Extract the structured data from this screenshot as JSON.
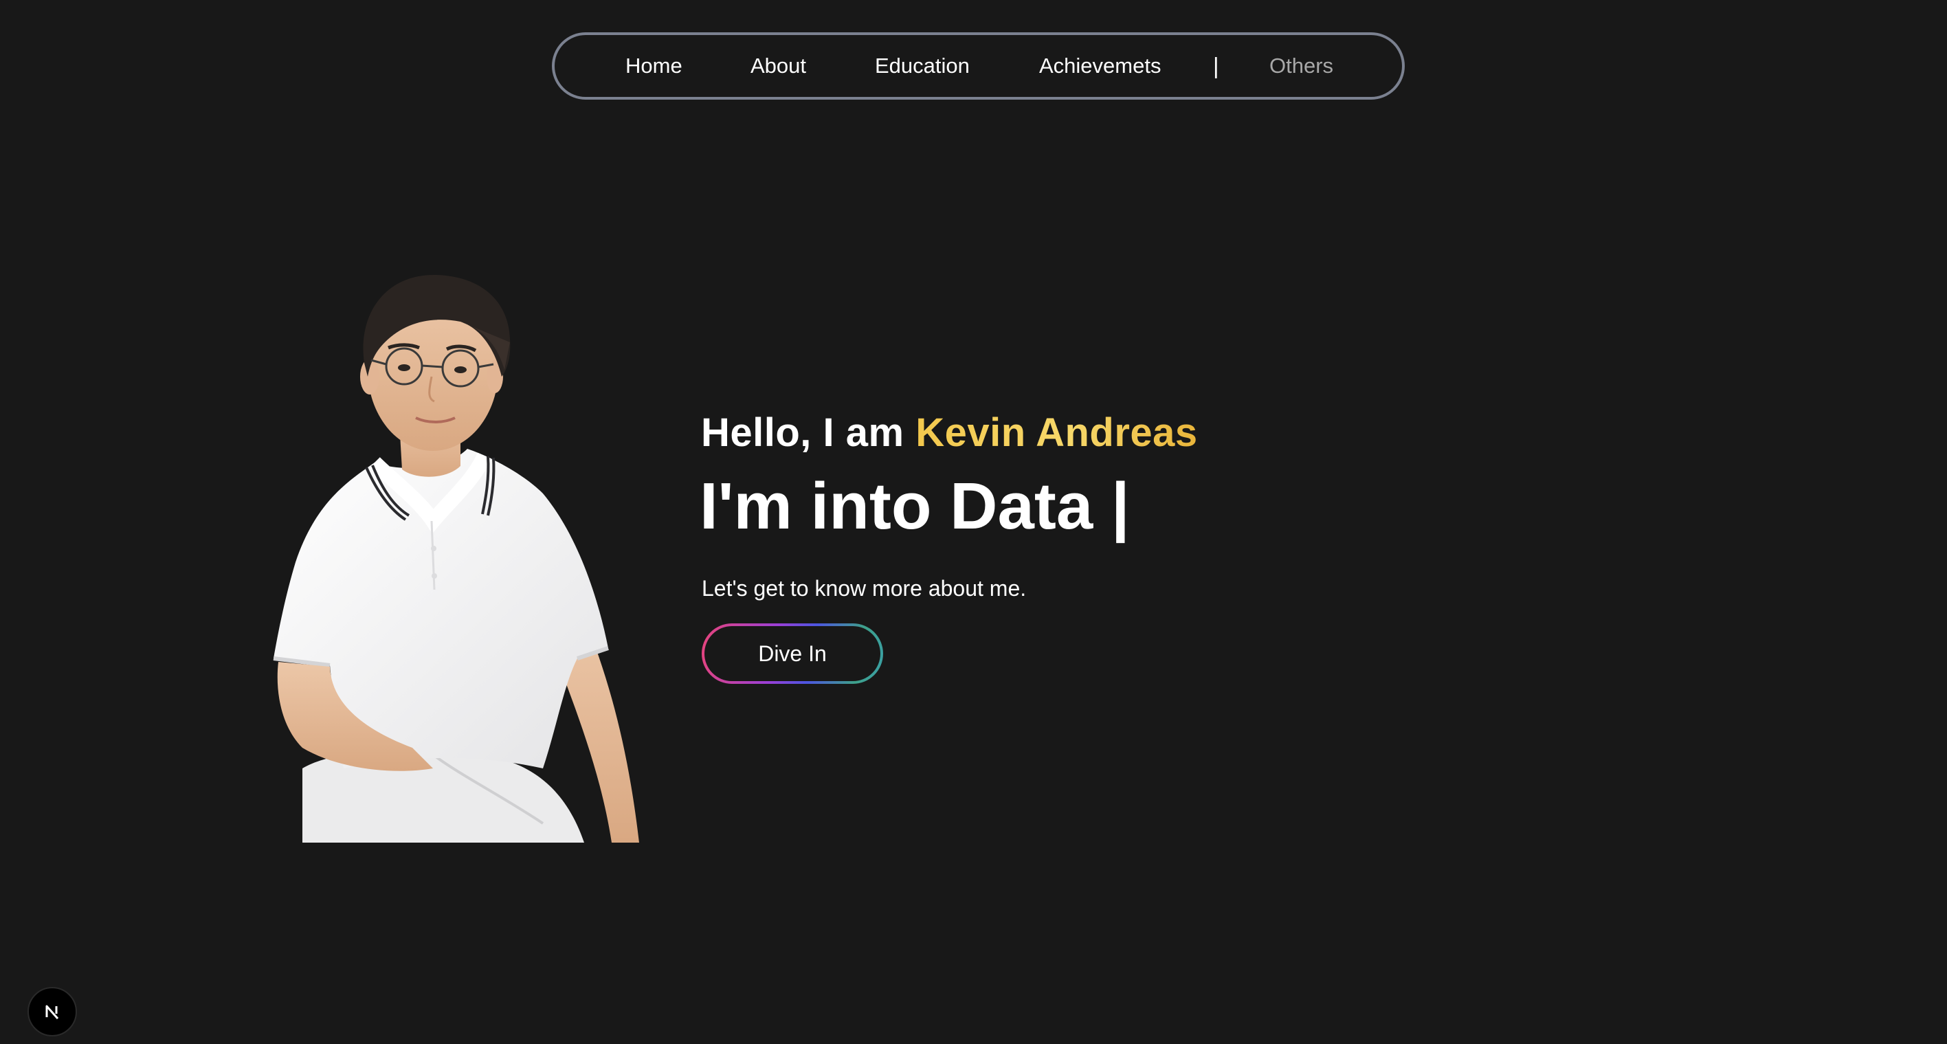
{
  "nav": {
    "items": [
      {
        "label": "Home"
      },
      {
        "label": "About"
      },
      {
        "label": "Education"
      },
      {
        "label": "Achievemets"
      }
    ],
    "divider": "|",
    "others_label": "Others"
  },
  "hero": {
    "greeting_prefix": "Hello, I am ",
    "name": "Kevin Andreas",
    "headline": "I'm into Data |",
    "tagline": "Let's get to know more about me.",
    "cta_label": "Dive In"
  },
  "colors": {
    "background": "#181818",
    "name_gold": "#f3c84d",
    "nav_border": "#7b8190"
  },
  "badge": {
    "icon": "nextjs-logo-icon"
  }
}
